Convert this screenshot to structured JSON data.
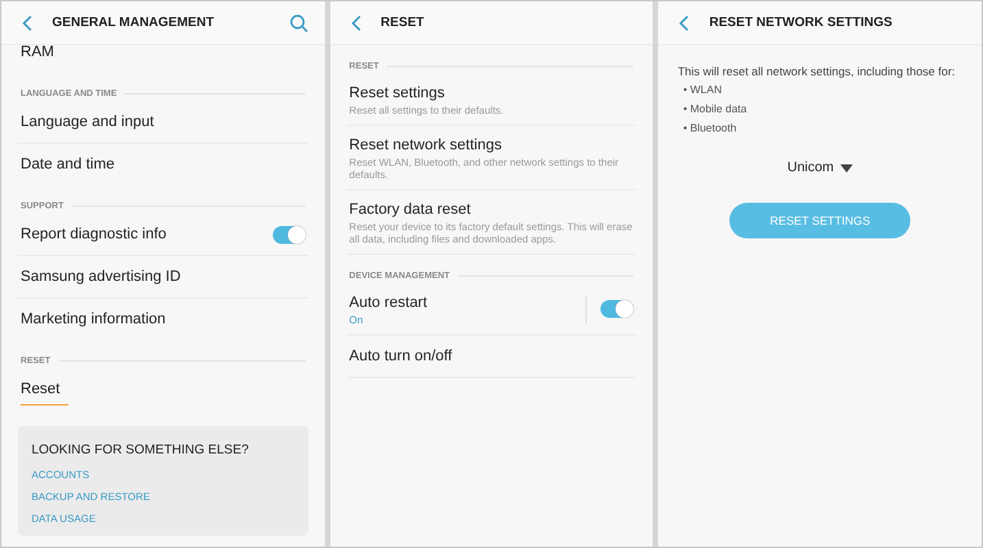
{
  "screens": [
    {
      "title": "GENERAL MANAGEMENT",
      "search": true,
      "rows": [
        {
          "kind": "item",
          "title": "RAM",
          "selected": false
        },
        {
          "kind": "section",
          "label": "LANGUAGE AND TIME"
        },
        {
          "kind": "item",
          "title": "Language and input",
          "selected": false
        },
        {
          "kind": "item",
          "title": "Date and time",
          "selected": false
        },
        {
          "kind": "section",
          "label": "SUPPORT"
        },
        {
          "kind": "item",
          "title": "Report diagnostic info",
          "selected": false,
          "toggle": {
            "on": true
          }
        },
        {
          "kind": "item",
          "title": "Samsung advertising ID",
          "selected": false
        },
        {
          "kind": "item",
          "title": "Marketing information",
          "selected": false
        },
        {
          "kind": "section",
          "label": "RESET"
        },
        {
          "kind": "item",
          "title": "Reset",
          "selected": true
        }
      ],
      "card": {
        "title": "LOOKING FOR SOMETHING ELSE?",
        "links": [
          "ACCOUNTS",
          "BACKUP AND RESTORE",
          "DATA USAGE"
        ]
      }
    },
    {
      "title": "RESET",
      "search": false,
      "rows": [
        {
          "kind": "section",
          "label": "RESET"
        },
        {
          "kind": "item",
          "title": "Reset settings",
          "subtitle": "Reset all settings to their defaults.",
          "selected": false
        },
        {
          "kind": "item",
          "title": "Reset network settings",
          "subtitle": "Reset WLAN, Bluetooth, and other network settings to their defaults.",
          "selected": false
        },
        {
          "kind": "item",
          "title": "Factory data reset",
          "subtitle": "Reset your device to its factory default settings. This will erase all data, including files and downloaded apps.",
          "selected": false
        },
        {
          "kind": "section",
          "label": "DEVICE MANAGEMENT"
        },
        {
          "kind": "item",
          "title": "Auto restart",
          "status": "On",
          "selected": false,
          "toggle": {
            "on": true
          }
        },
        {
          "kind": "item",
          "title": "Auto turn on/off",
          "selected": false
        }
      ]
    },
    {
      "title": "RESET NETWORK SETTINGS",
      "search": false,
      "body": {
        "text": "This will reset all network settings, including those for:",
        "bullets": [
          "• WLAN",
          "• Mobile data",
          "• Bluetooth"
        ],
        "dropdown": "Unicom",
        "button": "RESET SETTINGS"
      }
    }
  ]
}
